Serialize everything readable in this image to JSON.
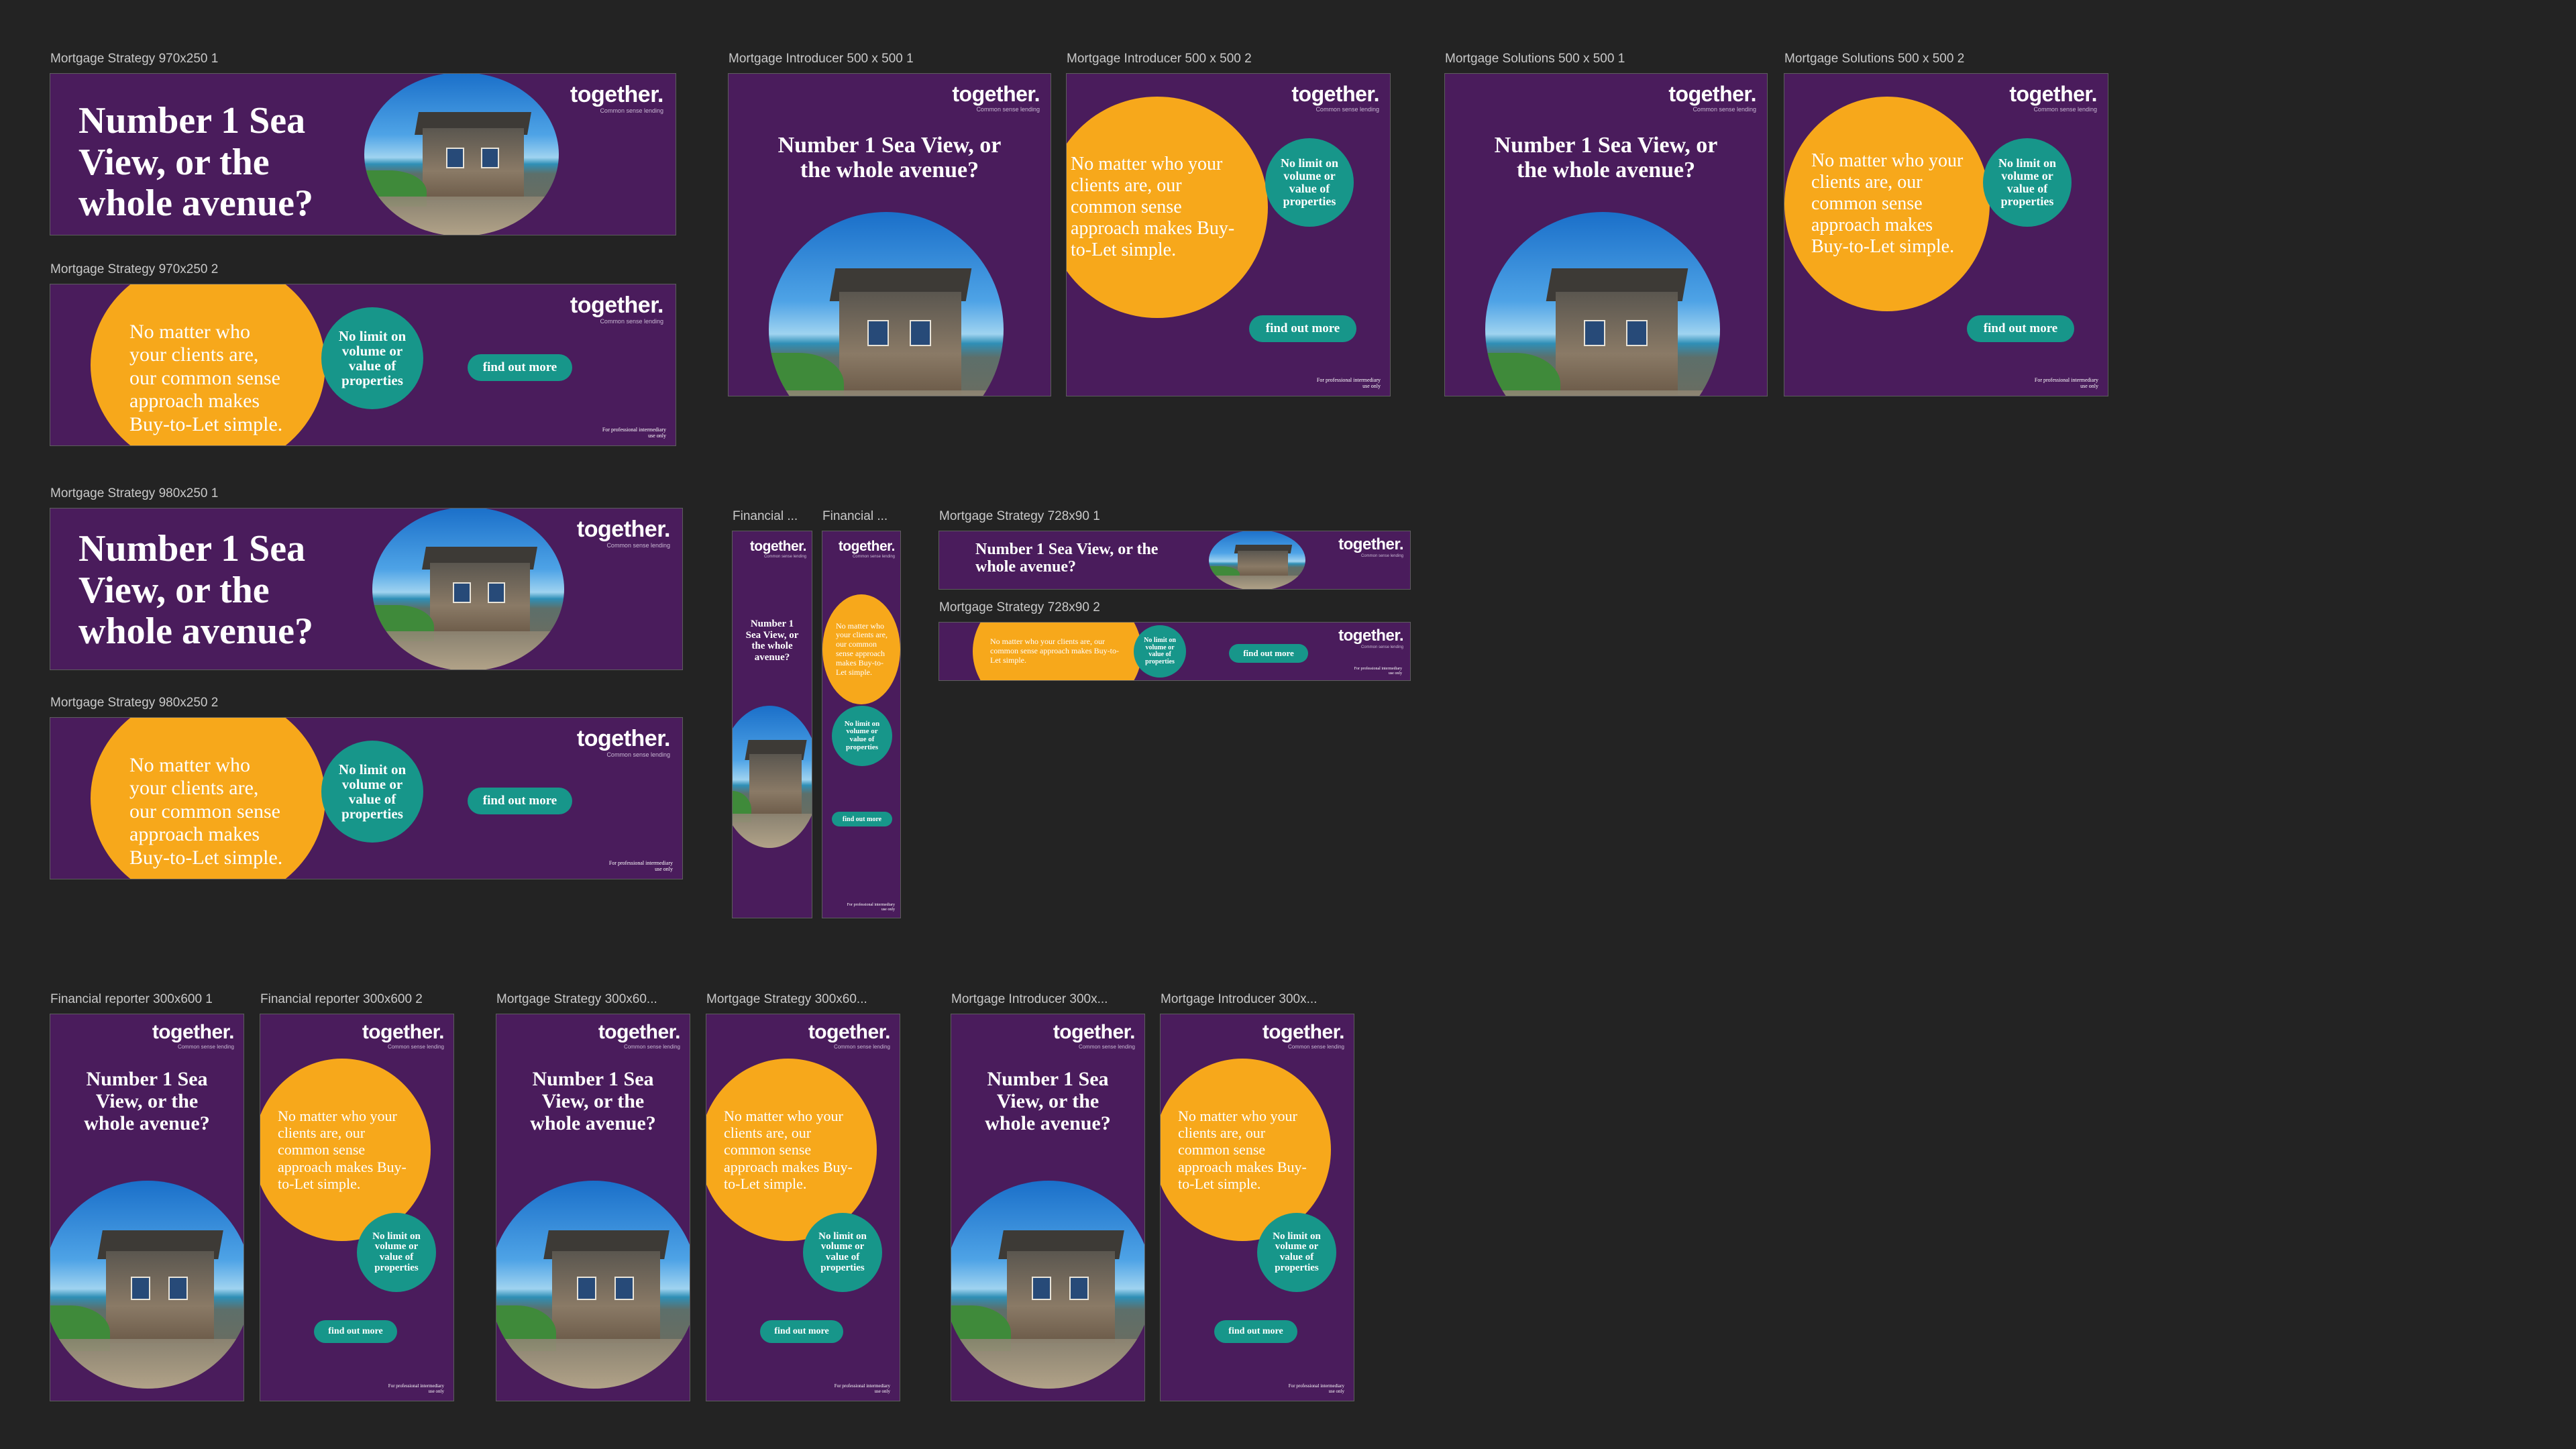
{
  "brand": {
    "logo": "together.",
    "tagline": "Common sense lending",
    "headline": "Number 1 Sea View, or the whole avenue?",
    "body": "No matter who your clients are, our common sense approach makes Buy-to-Let simple.",
    "badge": "No limit on volume or value of properties",
    "cta": "find out more",
    "disclaimer": "For professional intermediary use only"
  },
  "colors": {
    "background": "#232323",
    "purple": "#4a1c5c",
    "yellow": "#f7a81b",
    "teal": "#17968a",
    "label": "#c9c9c9"
  },
  "icons": [
    "house-photo",
    "yellow-circle",
    "teal-circle"
  ],
  "artboards": {
    "ms970_1": "Mortgage Strategy 970x250 1",
    "ms970_2": "Mortgage Strategy 970x250 2",
    "ms980_1": "Mortgage Strategy 980x250 1",
    "ms980_2": "Mortgage Strategy 980x250 2",
    "mi500_1": "Mortgage Introducer 500 x 500 1",
    "mi500_2": "Mortgage Introducer 500 x 500 2",
    "msol500_1": "Mortgage Solutions 500 x 500 1",
    "msol500_2": "Mortgage Solutions 500 x 500 2",
    "fin_sky_1": "Financial ...",
    "fin_sky_2": "Financial ...",
    "ms728_1": "Mortgage Strategy 728x90 1",
    "ms728_2": "Mortgage Strategy 728x90 2",
    "fr300_1": "Financial reporter 300x600 1",
    "fr300_2": "Financial reporter 300x600 2",
    "ms300_1": "Mortgage Strategy 300x60...",
    "ms300_2": "Mortgage Strategy 300x60...",
    "mi300_1": "Mortgage Introducer 300x...",
    "mi300_2": "Mortgage Introducer 300x..."
  }
}
